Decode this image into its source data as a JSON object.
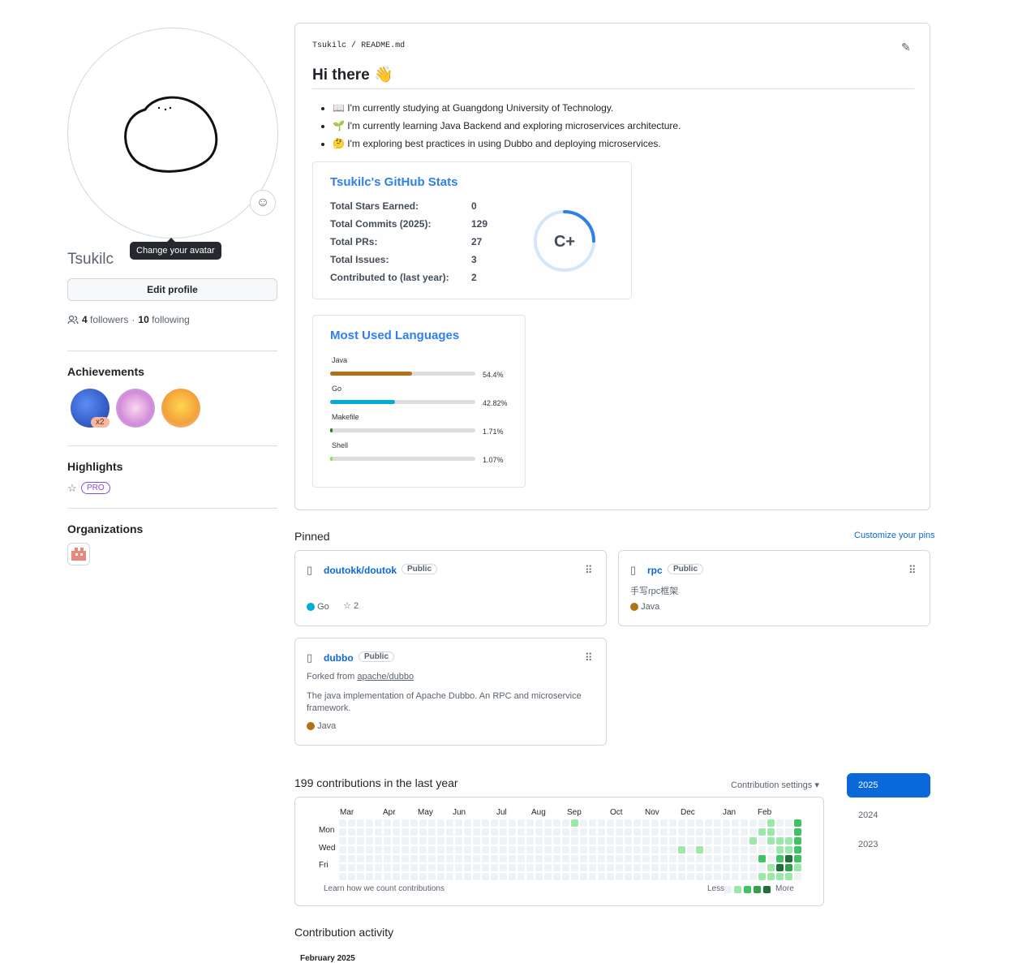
{
  "sidebar": {
    "username": "Tsukilc",
    "avatar_tooltip": "Change your avatar",
    "edit_profile": "Edit profile",
    "followers_count": "4",
    "followers_label": "followers",
    "separator": "·",
    "following_count": "10",
    "following_label": "following",
    "achievements_title": "Achievements",
    "achievement_count": "x2",
    "highlights_title": "Highlights",
    "pro_label": "PRO",
    "organizations_title": "Organizations"
  },
  "readme": {
    "path_user": "Tsukilc",
    "path_sep": "/",
    "path_file": "README.md",
    "heading": "Hi there 👋",
    "bullets": [
      "📖 I'm currently studying at Guangdong University of Technology.",
      "🌱 I'm currently learning Java Backend and exploring microservices architecture.",
      "🤔 I'm exploring best practices in using Dubbo and deploying microservices."
    ],
    "stats_card": {
      "title": "Tsukilc's GitHub Stats",
      "rows": [
        {
          "label": "Total Stars Earned:",
          "value": "0"
        },
        {
          "label": "Total Commits (2025):",
          "value": "129"
        },
        {
          "label": "Total PRs:",
          "value": "27"
        },
        {
          "label": "Total Issues:",
          "value": "3"
        },
        {
          "label": "Contributed to (last year):",
          "value": "2"
        }
      ],
      "grade": "C+",
      "grade_progress": 0.25
    },
    "lang_card": {
      "title": "Most Used Languages",
      "languages": [
        {
          "name": "Java",
          "percent": "54.4%",
          "value": 54.4,
          "color": "#b07219"
        },
        {
          "name": "Go",
          "percent": "42.82%",
          "value": 42.82,
          "color": "#00add8"
        },
        {
          "name": "Makefile",
          "percent": "1.71%",
          "value": 1.71,
          "color": "#427819"
        },
        {
          "name": "Shell",
          "percent": "1.07%",
          "value": 1.07,
          "color": "#89e051"
        }
      ]
    }
  },
  "pinned": {
    "title": "Pinned",
    "customize": "Customize your pins",
    "repos": [
      {
        "name": "doutokk/doutok",
        "visibility": "Public",
        "language": "Go",
        "lang_color": "#00add8",
        "stars": "2"
      },
      {
        "name": "rpc",
        "visibility": "Public",
        "description": "手写rpc框架",
        "language": "Java",
        "lang_color": "#b07219"
      },
      {
        "name": "dubbo",
        "visibility": "Public",
        "forked_prefix": "Forked from",
        "forked_from": "apache/dubbo",
        "description": "The java implementation of Apache Dubbo. An RPC and microservice framework.",
        "language": "Java",
        "lang_color": "#b07219"
      }
    ]
  },
  "contributions": {
    "title": "199 contributions in the last year",
    "settings": "Contribution settings",
    "months": [
      "Mar",
      "Apr",
      "May",
      "Jun",
      "Jul",
      "Aug",
      "Sep",
      "Oct",
      "Nov",
      "Dec",
      "Jan",
      "Feb"
    ],
    "days": [
      "Mon",
      "Wed",
      "Fri"
    ],
    "learn": "Learn how we count contributions",
    "less": "Less",
    "more": "More",
    "years": [
      "2025",
      "2024",
      "2023"
    ],
    "selected_year": "2025",
    "activity_title": "Contribution activity",
    "activity_month": "February 2025"
  },
  "colors": {
    "accent": "#0969da",
    "card_title": "#2f80ed",
    "levels": [
      "#ebedf0",
      "#9be9a8",
      "#40c463",
      "#30a14e",
      "#216e39"
    ]
  }
}
